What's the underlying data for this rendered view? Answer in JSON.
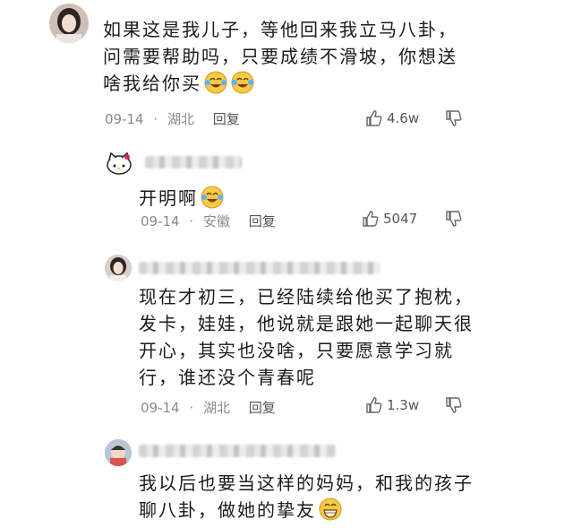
{
  "comments": [
    {
      "text": "如果这是我儿子，等他回来我立马八卦，\n问需要帮助吗，只要成绩不滑坡，你想送\n啥我给你买",
      "emojis": [
        "laugh-cry-emoji",
        "laugh-cry-emoji"
      ],
      "date": "09-14",
      "location": "湖北",
      "reply": "回复",
      "likes": "4.6w"
    },
    {
      "text": "开明啊",
      "emojis": [
        "laugh-cry-emoji"
      ],
      "date": "09-14",
      "location": "安徽",
      "reply": "回复",
      "likes": "5047"
    },
    {
      "text": "现在才初三，已经陆续给他买了抱枕，\n发卡，娃娃，他说就是跟她一起聊天很\n开心，其实也没啥，只要愿意学习就\n行，谁还没个青春呢",
      "emojis": [],
      "date": "09-14",
      "location": "湖北",
      "reply": "回复",
      "likes": "1.3w"
    },
    {
      "text": "我以后也要当这样的妈妈，和我的孩子\n聊八卦，做她的挚友",
      "emojis": [
        "grin-emoji"
      ],
      "date": "",
      "location": "",
      "reply": "",
      "likes": ""
    }
  ],
  "meta_separator": "·"
}
